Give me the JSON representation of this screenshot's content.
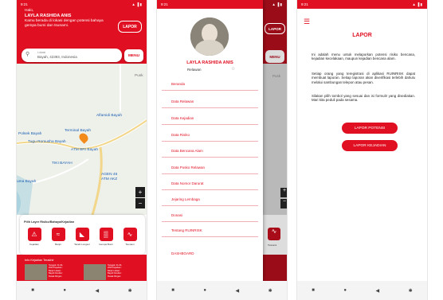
{
  "status_time": "9:21",
  "status_icons": "▲ ▐ ▮",
  "nav": {
    "square": "■",
    "circle": "●",
    "back": "◀",
    "person": "✱"
  },
  "home": {
    "greeting": "Halo,",
    "user_name": "LAYLA RASHIDA ANIS",
    "message": "Kamu berada di lokasi dengan potensi bahaya gempa bumi dan tsunami.",
    "lapor_label": "LAPOR",
    "search_caption": "Lokasi",
    "search_value": "Bayah, 42393, Indonesia",
    "menu_label": "MENU",
    "map_labels": {
      "puskesmas": "Pusk",
      "alfamidi": "Alfamidi Bayah",
      "terminal": "Terminal Bayah",
      "polsek": "Polsek Bayah",
      "tugu": "Tugu Romusha Bayah",
      "atm_bri": "ATM BRI Bayah",
      "tiki": "TIKI BAYAH",
      "agen": "AGEN 46",
      "atm_akz": "ATM AKZ",
      "rumah": "uma Bayah"
    },
    "zoom_in": "+",
    "zoom_out": "−",
    "choose_title": "Pilih Layer Risiko/Bahaya/Kejadian",
    "categories": [
      "Kejadian",
      "Banjir",
      "Tanah Longsor",
      "Gempa Bumi",
      "Tsunami"
    ],
    "category_icons": [
      "alert-icon",
      "flood-icon",
      "landslide-icon",
      "earthquake-icon",
      "tsunami-icon"
    ],
    "category_glyphs": [
      "⚠",
      "≈",
      "◣",
      "▒",
      "∿"
    ],
    "events_title": "Info Kejadian Terakhir",
    "events": [
      {
        "text": "Tanggal: 21-04-2024 Kejadian : Banjir Lokasi : Bayah Kondisi : Rusak Ringan"
      },
      {
        "text": "Tanggal: 21-04-2024 Kejadian : Banjir Lokasi : Bayah Kondisi : Rusak Ringan"
      }
    ]
  },
  "drawer": {
    "name": "LAYLA RASHIDA ANIS",
    "role": "Relawan",
    "items": [
      "Beranda",
      "Data Relawan",
      "Data Kejadian",
      "Data Risiko",
      "Data Bencana Alam",
      "Data Posko Relawan",
      "Data Nomor Darurat",
      "Jejaring Lembaga",
      "Donasi",
      "Tentang RUINRISK"
    ],
    "dashboard": "DASHBOARD",
    "lapor_label": "LAPOR",
    "menu_label": "MENU",
    "right_peek": "Pusk",
    "tsunami_label": "Tsunami"
  },
  "lapor": {
    "title": "LAPOR",
    "para1": "Ini adalah menu untuk melaporkan potensi risiko bencana, kejadian kecelakaan, maupun kejadian bencana alam.",
    "para2": "Setiap orang yang teregistrasi di aplikasi RUINRISK dapat membuat laporan. Setiap laporan akan diverifikasi terlebih dahulu melalui sambungan telepon atau pesan.",
    "para3": "Silakan pilih tombol yang sesuai dan isi formulir yang disediakan. Mari kita peduli pada sesama.",
    "btn_potensi": "LAPOR POTENSI",
    "btn_kejadian": "LAPOR KEJADIAN"
  }
}
